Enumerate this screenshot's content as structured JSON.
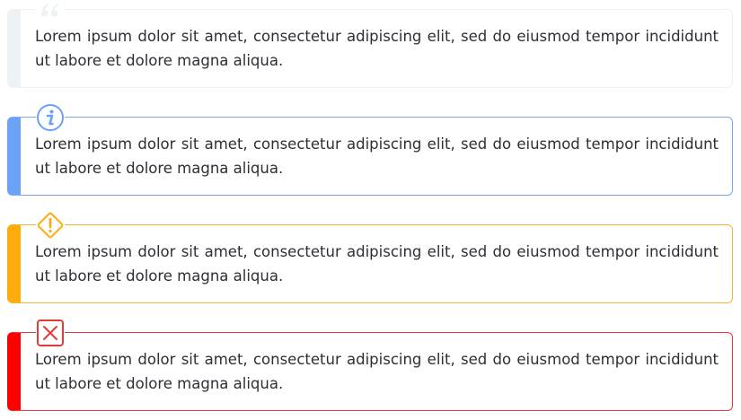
{
  "callouts": [
    {
      "variant": "quote",
      "icon": "quote-icon",
      "accent": "#eef1f6",
      "text": "Lorem ipsum dolor sit amet, consectetur adipiscing elit, sed do eiusmod tempor incididunt ut labore et dolore magna aliqua."
    },
    {
      "variant": "info",
      "icon": "info-icon",
      "accent": "#6aa2f8",
      "text": "Lorem ipsum dolor sit amet, consectetur adipiscing elit, sed do eiusmod tempor incididunt ut labore et dolore magna aliqua."
    },
    {
      "variant": "warning",
      "icon": "warning-icon",
      "accent": "#fdac0b",
      "text": "Lorem ipsum dolor sit amet, consectetur adipiscing elit, sed do eiusmod tempor incididunt ut labore et dolore magna aliqua."
    },
    {
      "variant": "error",
      "icon": "error-icon",
      "accent": "#ff0000",
      "text": "Lorem ipsum dolor sit amet, consectetur adipiscing elit, sed do eiusmod tempor incididunt ut labore et dolore magna aliqua."
    }
  ]
}
